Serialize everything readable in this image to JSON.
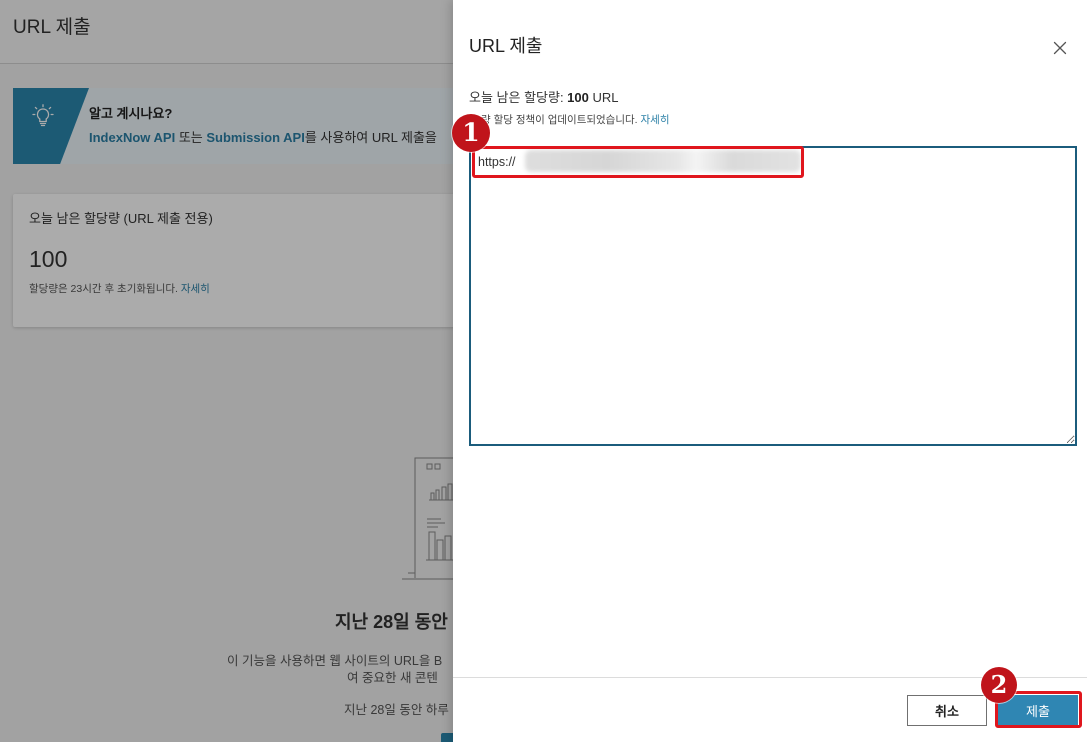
{
  "colors": {
    "accent": "#2a7fa6",
    "accent_strip": "#2b87ad",
    "submit_button": "#2f86b3",
    "textarea_border": "#1b5c7c",
    "annotation_red": "#e0161d",
    "annotation_badge": "#c0141b",
    "overlay": "rgba(0, 0, 0, 0.33)"
  },
  "background_page": {
    "header": {
      "title": "URL 제출"
    },
    "tip_banner": {
      "icon": "lightbulb-icon",
      "heading": "알고 계시나요?",
      "indexnow_link": "IndexNow API",
      "joiner": " 또는 ",
      "submission_link": "Submission API",
      "text": "를 사용하여 URL 제출을"
    },
    "quota_card": {
      "label": "오늘 남은 할당량 (URL 제출 전용)",
      "value": "100",
      "reset_text": "할당량은 23시간 후 초기화됩니다. ",
      "details_link": "자세히"
    },
    "empty_state": {
      "heading": "지난 28일 동안",
      "description_line_1": "이 기능을 사용하면 웹 사이트의 URL을 B",
      "description_line_2": "여 중요한 새 콘텐",
      "note": "지난 28일 동안 하루"
    }
  },
  "panel": {
    "title": "URL 제출",
    "close_icon": "close-icon",
    "quota": {
      "label": "오늘 남은 할당량: ",
      "value": "100",
      "unit": " URL"
    },
    "policy": {
      "text": "량 할당 정책이 업데이트되었습니다. ",
      "link": "자세히"
    },
    "textarea": {
      "value": "https://"
    },
    "footer": {
      "cancel_label": "취소",
      "submit_label": "제출"
    }
  },
  "annotations": [
    {
      "number": "1"
    },
    {
      "number": "2"
    }
  ]
}
